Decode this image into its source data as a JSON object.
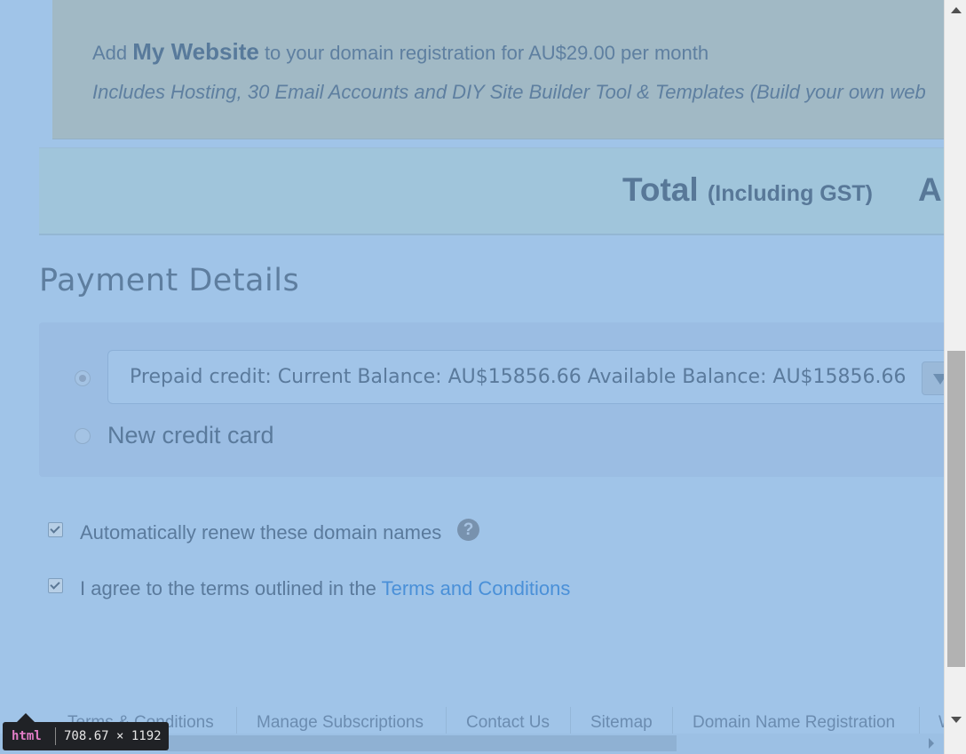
{
  "upsell": {
    "prefix": "Add ",
    "product": "My Website",
    "suffix": " to your domain registration for AU$29.00 per month",
    "description": "Includes Hosting, 30 Email Accounts and DIY Site Builder Tool & Templates (Build your own web"
  },
  "total": {
    "label": "Total",
    "qualifier": "(Including GST)",
    "amount_prefix": "A"
  },
  "payment": {
    "heading": "Payment Details",
    "prepaid_option": "Prepaid credit: Current Balance: AU$15856.66 Available Balance: AU$15856.66",
    "new_card_label": "New credit card",
    "selected": "prepaid"
  },
  "options": {
    "auto_renew_label": "Automatically renew these domain names",
    "auto_renew_checked": true,
    "help_glyph": "?",
    "terms_prefix": "I agree to the terms outlined in the ",
    "terms_link": "Terms and Conditions",
    "terms_checked": true
  },
  "footer": {
    "links": [
      "Terms & Conditions",
      "Manage Subscriptions",
      "Contact Us",
      "Sitemap",
      "Domain Name Registration",
      "W"
    ]
  },
  "devtools_tooltip": {
    "tag": "html",
    "dimensions": "708.67 × 1192"
  }
}
